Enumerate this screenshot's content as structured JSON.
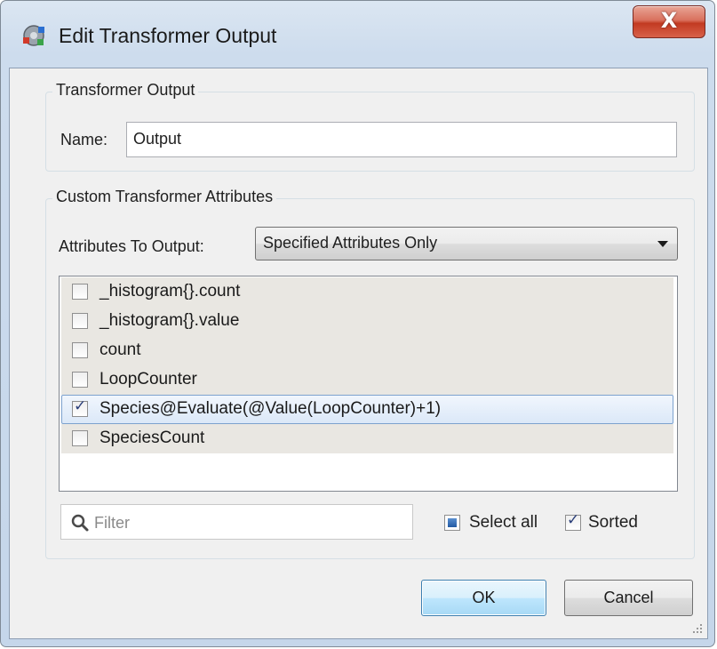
{
  "window": {
    "title": "Edit Transformer Output",
    "close_label": "X",
    "icon": "fme-transformer-icon"
  },
  "output_group": {
    "title": "Transformer Output",
    "name_label": "Name:",
    "name_value": "Output"
  },
  "attributes_group": {
    "title": "Custom Transformer Attributes",
    "output_label": "Attributes To Output:",
    "output_selected": "Specified Attributes Only",
    "items": [
      {
        "label": "_histogram{}.count",
        "checked": false
      },
      {
        "label": "_histogram{}.value",
        "checked": false
      },
      {
        "label": "count",
        "checked": false
      },
      {
        "label": "LoopCounter",
        "checked": false
      },
      {
        "label": "Species@Evaluate(@Value(LoopCounter)+1)",
        "checked": true
      },
      {
        "label": "SpeciesCount",
        "checked": false
      }
    ],
    "filter_placeholder": "Filter",
    "select_all_label": "Select all",
    "select_all_state": "partial",
    "sorted_label": "Sorted",
    "sorted_checked": true
  },
  "buttons": {
    "ok": "OK",
    "cancel": "Cancel"
  },
  "colors": {
    "selected_row_border": "#7da2ce",
    "close_button": "#c23a22",
    "default_button_border": "#3c7fb1"
  }
}
